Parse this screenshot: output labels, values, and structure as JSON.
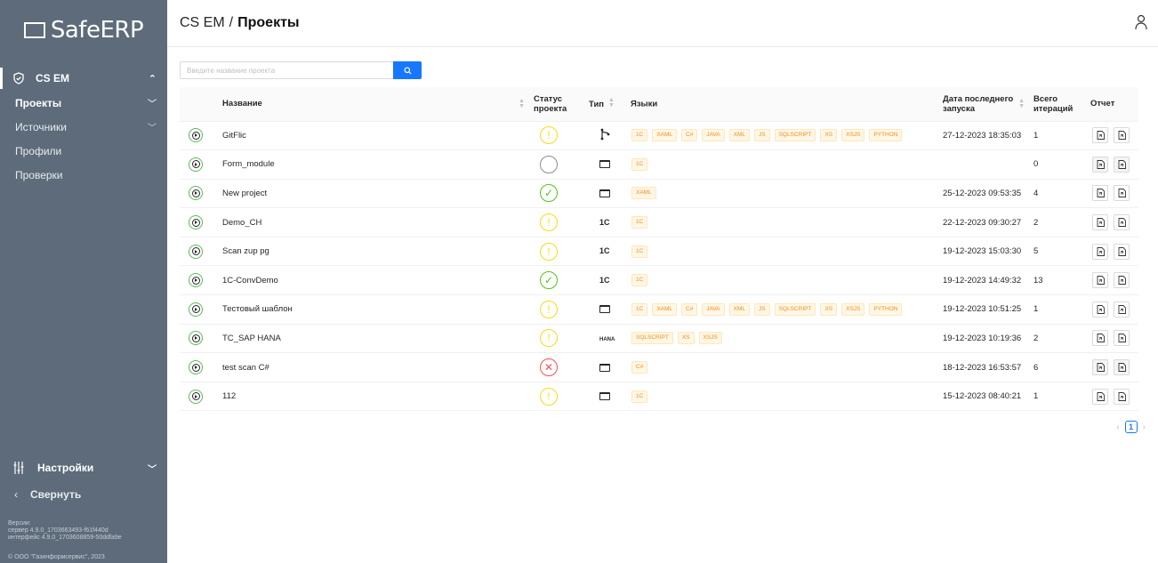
{
  "brand": {
    "logo_text": "SafeERP"
  },
  "sidebar": {
    "group": {
      "label": "CS EM",
      "chevron": "chevron-up-icon"
    },
    "items": [
      {
        "label": "Проекты",
        "active": true,
        "has_chevron": true
      },
      {
        "label": "Источники",
        "active": false,
        "has_chevron": true
      },
      {
        "label": "Профили",
        "active": false,
        "has_chevron": false
      },
      {
        "label": "Проверки",
        "active": false,
        "has_chevron": false
      }
    ],
    "settings_label": "Настройки",
    "collapse_label": "Свернуть",
    "version_title": "Версии:",
    "version_server": "сервер 4.9.0_1703663493-f61f440d",
    "version_ui": "интерфейс 4.9.0_1703608859-50ddfa9e",
    "copyright": "© ООО \"Газинформсервис\", 2023"
  },
  "header": {
    "crumb_parent": "CS EM",
    "crumb_sep": "/",
    "crumb_current": "Проекты"
  },
  "search": {
    "placeholder": "Введите название проекта",
    "value": ""
  },
  "table": {
    "columns": {
      "name": "Название",
      "status_line1": "Статус",
      "status_line2": "проекта",
      "type": "Тип",
      "langs": "Языки",
      "date_line1": "Дата последнего",
      "date_line2": "запуска",
      "iter_line1": "Всего",
      "iter_line2": "итераций",
      "report": "Отчет"
    },
    "rows": [
      {
        "name": "GitFlic",
        "status": "warning",
        "type": "git",
        "langs": [
          "1C",
          "XAML",
          "C#",
          "JAVA",
          "XML",
          "JS",
          "SQLSCRIPT",
          "XS",
          "XSJS",
          "PYTHON"
        ],
        "date": "27-12-2023 18:35:03",
        "iterations": "1",
        "report_enabled": true
      },
      {
        "name": "Form_module",
        "status": "none",
        "type": "folder",
        "langs": [
          "1C"
        ],
        "date": "",
        "iterations": "0",
        "report_enabled": false
      },
      {
        "name": "New project",
        "status": "success",
        "type": "folder",
        "langs": [
          "XAML"
        ],
        "date": "25-12-2023 09:53:35",
        "iterations": "4",
        "report_enabled": true
      },
      {
        "name": "Demo_CH",
        "status": "warning",
        "type": "1c",
        "langs": [
          "1C"
        ],
        "date": "22-12-2023 09:30:27",
        "iterations": "2",
        "report_enabled": true
      },
      {
        "name": "Scan zup pg",
        "status": "warning",
        "type": "1c",
        "langs": [
          "1C"
        ],
        "date": "19-12-2023 15:03:30",
        "iterations": "5",
        "report_enabled": true
      },
      {
        "name": "1C-ConvDemo",
        "status": "success",
        "type": "1c",
        "langs": [
          "1C"
        ],
        "date": "19-12-2023 14:49:32",
        "iterations": "13",
        "report_enabled": true
      },
      {
        "name": "Тестовый шаблон",
        "status": "warning",
        "type": "folder",
        "langs": [
          "1C",
          "XAML",
          "C#",
          "JAVA",
          "XML",
          "JS",
          "SQLSCRIPT",
          "XS",
          "XSJS",
          "PYTHON"
        ],
        "date": "19-12-2023 10:51:25",
        "iterations": "1",
        "report_enabled": true
      },
      {
        "name": "TC_SAP HANA",
        "status": "warning",
        "type": "hana",
        "langs": [
          "SQLSCRIPT",
          "XS",
          "XSJS"
        ],
        "date": "19-12-2023 10:19:36",
        "iterations": "2",
        "report_enabled": true
      },
      {
        "name": "test scan C#",
        "status": "error",
        "type": "folder",
        "langs": [
          "C#"
        ],
        "date": "18-12-2023 16:53:57",
        "iterations": "6",
        "report_enabled": false
      },
      {
        "name": "112",
        "status": "warning",
        "type": "folder",
        "langs": [
          "1C"
        ],
        "date": "15-12-2023 08:40:21",
        "iterations": "1",
        "report_enabled": true
      }
    ],
    "type_labels": {
      "1c": "1C",
      "hana": "HANA"
    }
  },
  "pagination": {
    "current": "1",
    "prev": "‹",
    "next": "›"
  },
  "colors": {
    "sidebar": "#5d6b7a",
    "primary": "#1677ff",
    "warning": "#fadb14",
    "success": "#52c41a",
    "error": "#ff4d4f",
    "tag_bg": "#fff7e6",
    "tag_text": "#fa8c16"
  }
}
